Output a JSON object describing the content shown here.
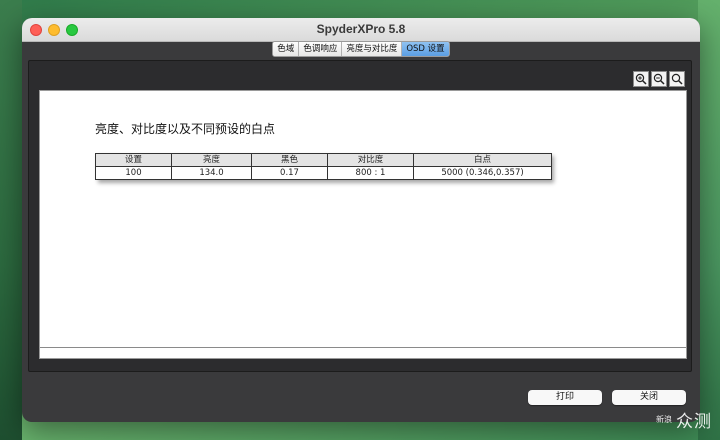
{
  "window": {
    "title": "SpyderXPro 5.8"
  },
  "tabs": [
    {
      "label": "色域",
      "active": false
    },
    {
      "label": "色调响应",
      "active": false
    },
    {
      "label": "亮度与对比度",
      "active": false
    },
    {
      "label": "OSD 设置",
      "active": true
    }
  ],
  "zoom": {
    "icons": [
      "zoom-in-icon",
      "zoom-out-icon",
      "zoom-reset-icon"
    ]
  },
  "report": {
    "heading": "亮度、对比度以及不同预设的白点",
    "columns": [
      "设置",
      "亮度",
      "黑色",
      "对比度",
      "白点"
    ],
    "rows": [
      [
        "100",
        "134.0",
        "0.17",
        "800 : 1",
        "5000 (0.346,0.357)"
      ]
    ]
  },
  "buttons": {
    "print": "打印",
    "close": "关闭"
  },
  "watermark": {
    "small": "新浪",
    "big": "众测"
  },
  "colors": {
    "active_tab": "#5b9ee3",
    "window_bg": "#3a3a3c"
  }
}
